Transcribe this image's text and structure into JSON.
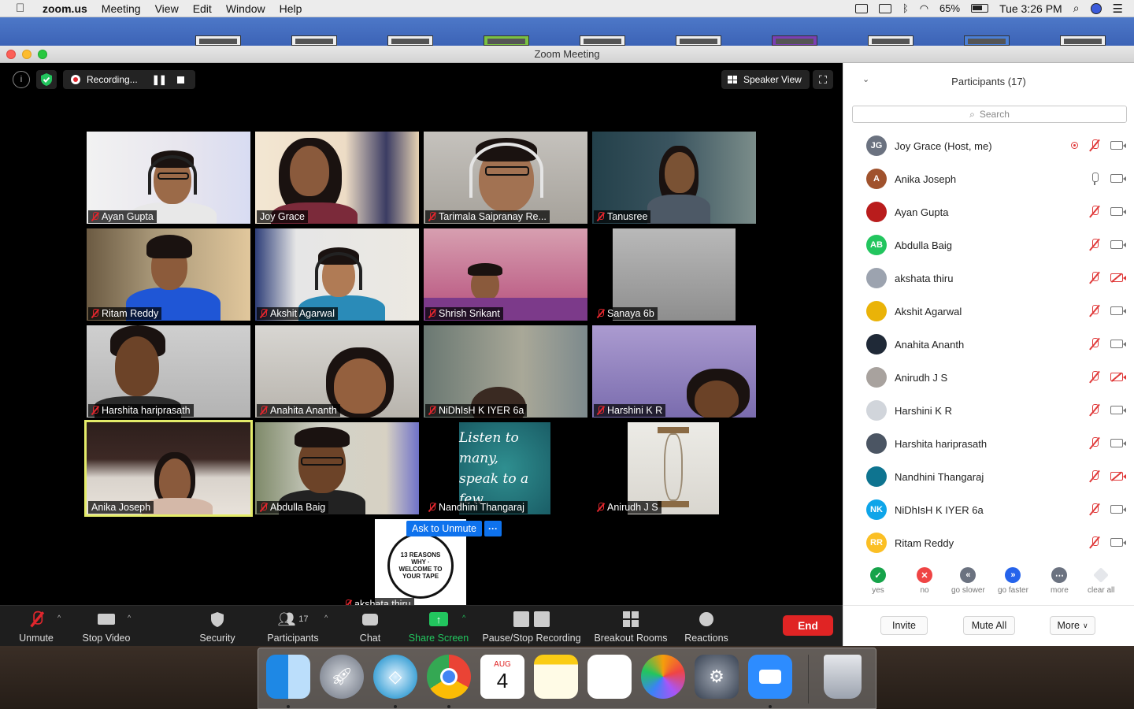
{
  "menubar": {
    "app_name": "zoom.us",
    "menus": [
      "Meeting",
      "View",
      "Edit",
      "Window",
      "Help"
    ],
    "battery": "65%",
    "clock": "Tue 3:26 PM"
  },
  "window": {
    "title": "Zoom Meeting"
  },
  "video_top": {
    "recording_label": "Recording...",
    "speaker_view_label": "Speaker View"
  },
  "tiles": [
    {
      "name": "Ayan Gupta"
    },
    {
      "name": "Joy Grace"
    },
    {
      "name": "Tarimala Saipranay Re..."
    },
    {
      "name": "Tanusree"
    },
    {
      "name": "Ritam Reddy"
    },
    {
      "name": "Akshit Agarwal"
    },
    {
      "name": "Shrish Srikant"
    },
    {
      "name": "Sanaya 6b"
    },
    {
      "name": "Harshita hariprasath"
    },
    {
      "name": "Anahita Ananth"
    },
    {
      "name": "NiDhIsH K IYER 6a"
    },
    {
      "name": "Harshini K R"
    },
    {
      "name": "Anika Joseph"
    },
    {
      "name": "Abdulla Baig"
    },
    {
      "name": "Nandhini Thangaraj"
    },
    {
      "name": "Anirudh J S"
    },
    {
      "name": "akshata thiru"
    }
  ],
  "nandhini_quote": [
    "Listen to many,",
    "speak to a few"
  ],
  "akshata_tile": {
    "ask_to_unmute": "Ask to Unmute",
    "more": "···",
    "art_text": "13 REASONS WHY · WELCOME TO YOUR TAPE"
  },
  "toolbar": {
    "unmute": "Unmute",
    "stop_video": "Stop Video",
    "security": "Security",
    "participants": "Participants",
    "participants_count": "17",
    "chat": "Chat",
    "share_screen": "Share Screen",
    "pause_stop_recording": "Pause/Stop Recording",
    "breakout_rooms": "Breakout Rooms",
    "reactions": "Reactions",
    "end": "End"
  },
  "panel": {
    "title": "Participants (17)",
    "search_placeholder": "Search",
    "participants": [
      {
        "name": "Joy Grace (Host, me)",
        "initials": "JG",
        "color": "#6b7280",
        "mic": "muted",
        "cam": "on"
      },
      {
        "name": "Anika Joseph",
        "initials": "A",
        "color": "#a0522d",
        "mic": "on",
        "cam": "on"
      },
      {
        "name": "Ayan Gupta",
        "initials": "",
        "color": "#b91c1c",
        "mic": "muted",
        "cam": "on"
      },
      {
        "name": "Abdulla Baig",
        "initials": "AB",
        "color": "#22c55e",
        "mic": "muted",
        "cam": "on"
      },
      {
        "name": "akshata thiru",
        "initials": "",
        "color": "#9ca3af",
        "mic": "muted",
        "cam": "off"
      },
      {
        "name": "Akshit Agarwal",
        "initials": "",
        "color": "#eab308",
        "mic": "muted",
        "cam": "on"
      },
      {
        "name": "Anahita Ananth",
        "initials": "",
        "color": "#1f2937",
        "mic": "muted",
        "cam": "on"
      },
      {
        "name": "Anirudh J S",
        "initials": "",
        "color": "#a8a29e",
        "mic": "muted",
        "cam": "off"
      },
      {
        "name": "Harshini K R",
        "initials": "",
        "color": "#d1d5db",
        "mic": "muted",
        "cam": "on"
      },
      {
        "name": "Harshita hariprasath",
        "initials": "",
        "color": "#4b5563",
        "mic": "muted",
        "cam": "on"
      },
      {
        "name": "Nandhini Thangaraj",
        "initials": "",
        "color": "#0e7490",
        "mic": "muted",
        "cam": "off"
      },
      {
        "name": "NiDhIsH K IYER 6a",
        "initials": "NK",
        "color": "#0ea5e9",
        "mic": "muted",
        "cam": "on"
      },
      {
        "name": "Ritam Reddy",
        "initials": "RR",
        "color": "#fbbf24",
        "mic": "muted",
        "cam": "on"
      }
    ],
    "feedback": {
      "yes": "yes",
      "no": "no",
      "go_slower": "go slower",
      "go_faster": "go faster",
      "more": "more",
      "clear_all": "clear all"
    },
    "footer": {
      "invite": "Invite",
      "mute_all": "Mute All",
      "more": "More"
    }
  },
  "dock": {
    "calendar_month": "AUG",
    "calendar_day": "4"
  },
  "colors": {
    "accent_blue": "#0e72ed",
    "end_red": "#e02424",
    "share_green": "#22c55e",
    "muted_red": "#e03a3a",
    "active_speaker": "#e4ec6a"
  }
}
